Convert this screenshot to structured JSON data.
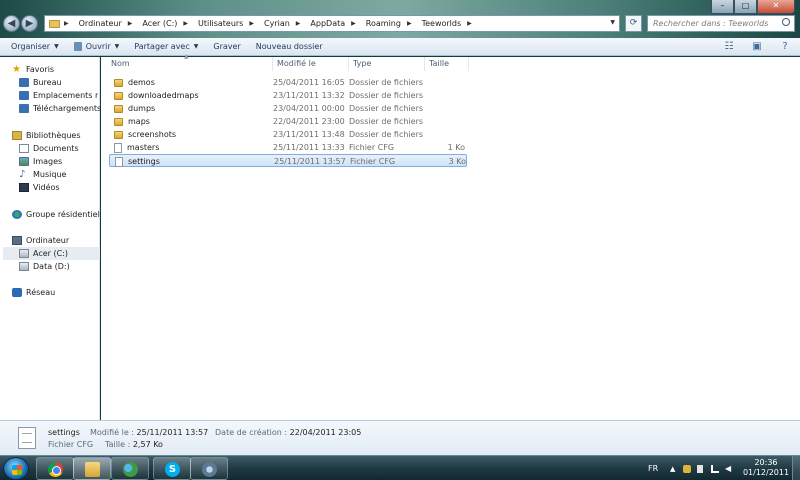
{
  "window": {
    "breadcrumb": [
      "Ordinateur",
      "Acer (C:)",
      "Utilisateurs",
      "Cyrian",
      "AppData",
      "Roaming",
      "Teeworlds"
    ],
    "search_placeholder": "Rechercher dans : Teeworlds",
    "buttons": {
      "minimize": "–",
      "maximize": "□",
      "close": "✕"
    }
  },
  "toolbar": {
    "organize": "Organiser",
    "open": "Ouvrir",
    "share": "Partager avec",
    "burn": "Graver",
    "new_folder": "Nouveau dossier"
  },
  "sidebar": {
    "favorites": "Favoris",
    "desktop": "Bureau",
    "recent": "Emplacements récents",
    "downloads": "Téléchargements",
    "libraries": "Bibliothèques",
    "documents": "Documents",
    "images": "Images",
    "music": "Musique",
    "videos": "Vidéos",
    "homegroup": "Groupe résidentiel",
    "computer": "Ordinateur",
    "drive_c": "Acer (C:)",
    "drive_d": "Data (D:)",
    "network": "Réseau"
  },
  "columns": {
    "name": "Nom",
    "modified": "Modifié le",
    "type": "Type",
    "size": "Taille"
  },
  "files": [
    {
      "name": "demos",
      "modified": "25/04/2011 16:05",
      "type": "Dossier de fichiers",
      "size": "",
      "kind": "folder"
    },
    {
      "name": "downloadedmaps",
      "modified": "23/11/2011 13:32",
      "type": "Dossier de fichiers",
      "size": "",
      "kind": "folder"
    },
    {
      "name": "dumps",
      "modified": "23/04/2011 00:00",
      "type": "Dossier de fichiers",
      "size": "",
      "kind": "folder"
    },
    {
      "name": "maps",
      "modified": "22/04/2011 23:00",
      "type": "Dossier de fichiers",
      "size": "",
      "kind": "folder"
    },
    {
      "name": "screenshots",
      "modified": "23/11/2011 13:48",
      "type": "Dossier de fichiers",
      "size": "",
      "kind": "folder"
    },
    {
      "name": "masters",
      "modified": "25/11/2011 13:33",
      "type": "Fichier CFG",
      "size": "1 Ko",
      "kind": "file"
    },
    {
      "name": "settings",
      "modified": "25/11/2011 13:57",
      "type": "Fichier CFG",
      "size": "3 Ko",
      "kind": "file",
      "selected": true
    }
  ],
  "details": {
    "name": "settings",
    "type": "Fichier CFG",
    "modified_label": "Modifié le :",
    "modified_value": "25/11/2011 13:57",
    "size_label": "Taille :",
    "size_value": "2,57 Ko",
    "created_label": "Date de création :",
    "created_value": "22/04/2011 23:05"
  },
  "taskbar": {
    "apps": [
      "chrome-icon",
      "explorer-icon",
      "people-icon",
      "skype-icon",
      "app-icon"
    ],
    "language": "FR",
    "time": "20:36",
    "date": "01/12/2011"
  }
}
